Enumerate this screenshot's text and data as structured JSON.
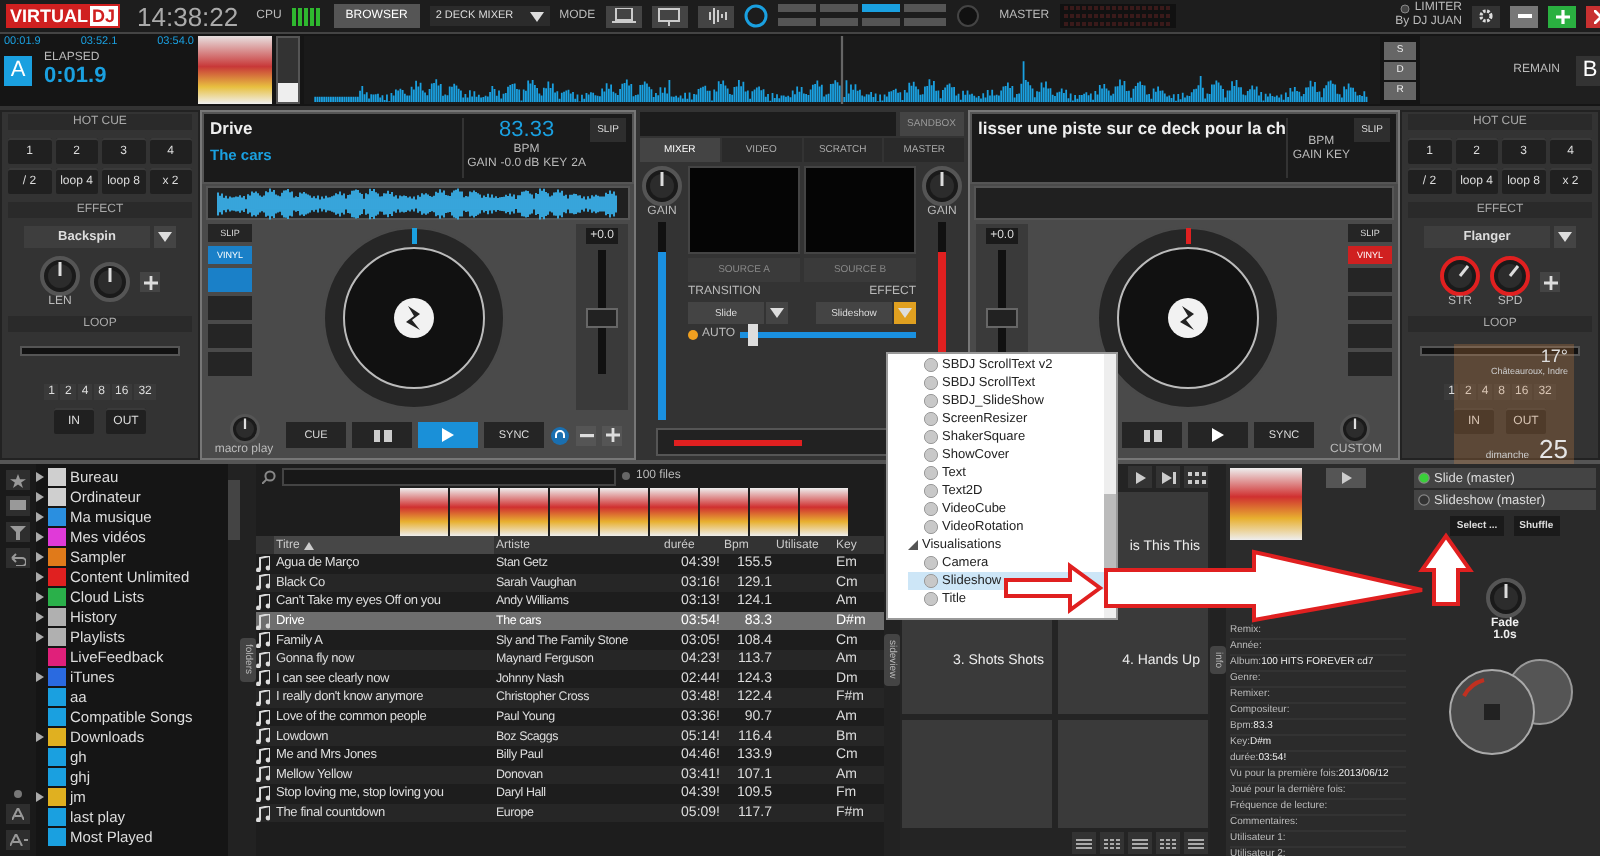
{
  "top_bar": {
    "logo_part_1": "VIRTUAL",
    "logo_part_2": "DJ",
    "clock": "14:38:22",
    "cpu_label": "CPU",
    "browser_tab": {
      "label": "BROWSER",
      "selected": true
    },
    "layout_dropdown": "2 DECK MIXER",
    "mode_label": "MODE",
    "master_label": "MASTER",
    "limiter_label": "LIMITER",
    "user_label": "By DJ JUAN"
  },
  "deck_a_header": {
    "times": [
      "00:01.9",
      "03:52.1",
      "03:54.0"
    ],
    "letter": "A",
    "elapsed_label": "ELAPSED",
    "elapsed": "0:01.9"
  },
  "waveform_buttons": [
    "S",
    "D",
    "R"
  ],
  "deck_b_header": {
    "remain_label": "REMAIN",
    "letter": "B"
  },
  "left_panel": {
    "hot_cue_title": "HOT CUE",
    "hot_cues": [
      "1",
      "2",
      "3",
      "4",
      "/ 2",
      "loop 4",
      "loop 8",
      "x 2"
    ],
    "effect_title": "EFFECT",
    "effect": "Backspin",
    "knob_labels": [
      "LEN"
    ],
    "loop_title": "LOOP",
    "loop_sizes": [
      "1",
      "2",
      "4",
      "8",
      "16",
      "32"
    ],
    "loop_buttons": [
      "IN",
      "OUT"
    ]
  },
  "deck_a": {
    "title": "Drive",
    "artist": "The cars",
    "bpm": "83.33",
    "bpm_label": "BPM",
    "slip_top": "SLIP",
    "gain_label": "GAIN",
    "gain": "-0.0 dB",
    "key_label": "KEY",
    "key": "2A",
    "side_buttons": [
      {
        "label": "SLIP",
        "selected": false
      },
      {
        "label": "VINYL",
        "selected": true
      }
    ],
    "pad_buttons": [
      {
        "on": true
      },
      {
        "on": false
      },
      {
        "on": false
      },
      {
        "on": false
      }
    ],
    "pitch": "+0.0",
    "pitch_fader": {
      "level": 0.45
    },
    "knob_label": "macro play",
    "transport": [
      {
        "kind": "text",
        "label": "CUE",
        "selected": false
      },
      {
        "kind": "pause",
        "selected": false
      },
      {
        "kind": "play",
        "selected": true
      },
      {
        "kind": "text",
        "label": "SYNC",
        "selected": false
      }
    ]
  },
  "mixer": {
    "top_button": "SANDBOX",
    "tabs": [
      {
        "label": "MIXER",
        "selected": true
      },
      {
        "label": "VIDEO",
        "selected": false
      },
      {
        "label": "SCRATCH",
        "selected": false
      },
      {
        "label": "MASTER",
        "selected": false
      }
    ],
    "gain_labels": [
      "GAIN",
      "GAIN"
    ],
    "channel_faders": [
      {
        "level": 0.85
      },
      {
        "level": 0.85
      }
    ],
    "sources": [
      "SOURCE A",
      "SOURCE B"
    ],
    "transition_label": "TRANSITION",
    "transition": "Slide",
    "effect_label": "EFFECT",
    "effect": "Slideshow",
    "auto_label": "AUTO",
    "video_crossfader": {
      "level": 0.05
    }
  },
  "deck_b": {
    "prompt": "lisser une piste sur ce deck pour la ch",
    "slip_top": "SLIP",
    "bpm_label": "BPM",
    "gain_label": "GAIN",
    "key_label": "KEY",
    "pitch": "+0.0",
    "pitch_fader": {
      "level": 0.45
    },
    "side_buttons": [
      {
        "label": "SLIP",
        "selected": false
      },
      {
        "label": "VINYL",
        "selected": true
      }
    ],
    "pad_buttons": [
      {
        "on": false
      },
      {
        "on": false
      },
      {
        "on": false
      },
      {
        "on": false
      }
    ],
    "knob_label": "CUSTOM",
    "transport": [
      {
        "kind": "pause",
        "selected": false
      },
      {
        "kind": "play",
        "selected": false
      },
      {
        "kind": "text",
        "label": "SYNC",
        "selected": false
      }
    ]
  },
  "right_panel": {
    "hot_cue_title": "HOT CUE",
    "hot_cues": [
      "1",
      "2",
      "3",
      "4",
      "/ 2",
      "loop 4",
      "loop 8",
      "x 2"
    ],
    "effect_title": "EFFECT",
    "effect": "Flanger",
    "knob_labels": [
      "STR",
      "SPD"
    ],
    "loop_title": "LOOP",
    "loop_sizes": [
      "1",
      "2",
      "4",
      "8",
      "16",
      "32"
    ],
    "loop_buttons": [
      "IN",
      "OUT"
    ]
  },
  "weather_widget": {
    "temperature": "17°",
    "location": "Châteauroux, Indre",
    "day": "dimanche",
    "date": "25"
  },
  "browser": {
    "folders": [
      {
        "label": "Bureau",
        "color": "#cfcfcf",
        "expandable": true
      },
      {
        "label": "Ordinateur",
        "color": "#cfcfcf",
        "expandable": true
      },
      {
        "label": "Ma musique",
        "color": "#2a8fe0",
        "expandable": true
      },
      {
        "label": "Mes vidéos",
        "color": "#e03ad8",
        "expandable": true
      },
      {
        "label": "Sampler",
        "color": "#e07a1a",
        "expandable": true
      },
      {
        "label": "Content Unlimited",
        "color": "#e02020",
        "expandable": true
      },
      {
        "label": "Cloud Lists",
        "color": "#2ab04a",
        "expandable": true
      },
      {
        "label": "History",
        "color": "#b0b0b0",
        "expandable": true
      },
      {
        "label": "Playlists",
        "color": "#b0b0b0",
        "expandable": true
      },
      {
        "label": "LiveFeedback",
        "color": "#e0207a",
        "expandable": false
      },
      {
        "label": "iTunes",
        "color": "#2a6ae0",
        "expandable": true
      },
      {
        "label": "aa",
        "color": "#1aa0e0",
        "expandable": false
      },
      {
        "label": "Compatible Songs",
        "color": "#1aa0e0",
        "expandable": false
      },
      {
        "label": "Downloads",
        "color": "#e0b020",
        "expandable": true
      },
      {
        "label": "gh",
        "color": "#1aa0e0",
        "expandable": false
      },
      {
        "label": "ghj",
        "color": "#1aa0e0",
        "expandable": false
      },
      {
        "label": "jm",
        "color": "#e0b020",
        "expandable": true
      },
      {
        "label": "last play",
        "color": "#1aa0e0",
        "expandable": false
      },
      {
        "label": "Most Played",
        "color": "#1aa0e0",
        "expandable": false
      }
    ],
    "files_count": "100 files",
    "side_tab": "folders",
    "columns": [
      {
        "label": "Titre",
        "sorted": true
      },
      {
        "label": "Artiste",
        "sorted": false
      },
      {
        "label": "durée",
        "sorted": false
      },
      {
        "label": "Bpm",
        "sorted": false
      },
      {
        "label": "Utilisate",
        "sorted": false
      },
      {
        "label": "Key",
        "sorted": false
      }
    ],
    "rows": [
      {
        "title": "Agua de Março",
        "artist": "Stan Getz",
        "duration": "04:39!",
        "bpm": "155.5",
        "key": "Em",
        "selected": false
      },
      {
        "title": "Black Co",
        "artist": "Sarah Vaughan",
        "duration": "03:16!",
        "bpm": "129.1",
        "key": "Cm",
        "selected": false
      },
      {
        "title": "Can't Take my eyes Off on you",
        "artist": "Andy Williams",
        "duration": "03:13!",
        "bpm": "124.1",
        "key": "Am",
        "selected": false
      },
      {
        "title": "Drive",
        "artist": "The cars",
        "duration": "03:54!",
        "bpm": "83.3",
        "key": "D#m",
        "selected": true
      },
      {
        "title": "Family A",
        "artist": "Sly and The Family Stone",
        "duration": "03:05!",
        "bpm": "108.4",
        "key": "Cm",
        "selected": false
      },
      {
        "title": "Gonna fly now",
        "artist": "Maynard Ferguson",
        "duration": "04:23!",
        "bpm": "113.7",
        "key": "Am",
        "selected": false
      },
      {
        "title": "I can see clearly now",
        "artist": "Johnny Nash",
        "duration": "02:44!",
        "bpm": "124.3",
        "key": "Dm",
        "selected": false
      },
      {
        "title": "I really don't know anymore",
        "artist": "Christopher Cross",
        "duration": "03:48!",
        "bpm": "122.4",
        "key": "F#m",
        "selected": false
      },
      {
        "title": "Love of the common people",
        "artist": "Paul Young",
        "duration": "03:36!",
        "bpm": "90.7",
        "key": "Am",
        "selected": false
      },
      {
        "title": "Lowdown",
        "artist": "Boz Scaggs",
        "duration": "05:14!",
        "bpm": "116.4",
        "key": "Bm",
        "selected": false
      },
      {
        "title": "Me and Mrs Jones",
        "artist": "Billy Paul",
        "duration": "04:46!",
        "bpm": "133.9",
        "key": "Cm",
        "selected": false
      },
      {
        "title": "Mellow Yellow",
        "artist": "Donovan",
        "duration": "03:41!",
        "bpm": "107.1",
        "key": "Am",
        "selected": false
      },
      {
        "title": "Stop loving me, stop loving you",
        "artist": "Daryl Hall",
        "duration": "04:39!",
        "bpm": "109.5",
        "key": "Fm",
        "selected": false
      },
      {
        "title": "The final countdown",
        "artist": "Europe",
        "duration": "05:09!",
        "bpm": "117.7",
        "key": "F#m",
        "selected": false
      }
    ]
  },
  "effects_menu": {
    "items": [
      {
        "label": "SBDJ ScrollText v2",
        "selected": false
      },
      {
        "label": "SBDJ ScrollText",
        "selected": false
      },
      {
        "label": "SBDJ_SlideShow",
        "selected": false
      },
      {
        "label": "ScreenResizer",
        "selected": false
      },
      {
        "label": "ShakerSquare",
        "selected": false
      },
      {
        "label": "ShowCover",
        "selected": false
      },
      {
        "label": "Text",
        "selected": false
      },
      {
        "label": "Text2D",
        "selected": false
      },
      {
        "label": "VideoCube",
        "selected": false
      },
      {
        "label": "VideoRotation",
        "selected": false
      }
    ],
    "groups": [
      {
        "label": "Visualisations",
        "expanded": true,
        "children": [
          {
            "label": "Camera",
            "selected": false
          },
          {
            "label": "Slideshow",
            "selected": true
          },
          {
            "label": "Title",
            "selected": false
          }
        ]
      }
    ]
  },
  "sampler": {
    "side_tab": "sideview",
    "pads": [
      {
        "label": "is This This"
      },
      {
        "label": "3. Shots Shots"
      },
      {
        "label": "4. Hands Up"
      }
    ]
  },
  "info_panel": {
    "side_tab": "info",
    "fields": [
      {
        "label": "Remix:"
      },
      {
        "label": "Année:"
      },
      {
        "label": "Album:",
        "value": "100 HITS FOREVER cd7"
      },
      {
        "label": "Genre:"
      },
      {
        "label": "Remixer:"
      },
      {
        "label": "Compositeur:"
      },
      {
        "label": "Bpm:",
        "value": "83.3"
      },
      {
        "label": "Key:",
        "value": "D#m"
      },
      {
        "label": "durée:",
        "value": "03:54!"
      },
      {
        "label": "Vu pour la première fois:",
        "value": "2013/06/12"
      },
      {
        "label": "Joué pour la dernière fois:"
      },
      {
        "label": "Fréquence de lecture:"
      },
      {
        "label": "Commentaires:"
      },
      {
        "label": "Utilisateur 1:"
      },
      {
        "label": "Utilisateur 2:"
      }
    ]
  },
  "video_effects": {
    "items": [
      {
        "label": "Slide (master)",
        "on": true
      },
      {
        "label": "Slideshow (master)",
        "on": false
      }
    ],
    "buttons": [
      "Select ...",
      "Shuffle"
    ],
    "fade_label": "Fade",
    "fade_value": "1.0s"
  }
}
